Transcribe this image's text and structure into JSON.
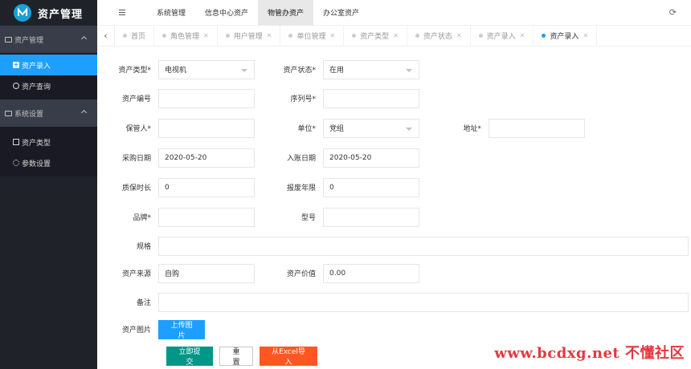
{
  "brand": {
    "title": "资产管理"
  },
  "sidebar": {
    "groups": [
      {
        "label": "资产管理",
        "items": [
          {
            "label": "资产录入"
          },
          {
            "label": "资产查询"
          }
        ]
      },
      {
        "label": "系统设置",
        "items": [
          {
            "label": "资产类型"
          },
          {
            "label": "参数设置"
          }
        ]
      }
    ]
  },
  "header": {
    "nav": [
      "系统管理",
      "信息中心资产",
      "物管办资产",
      "办公室资产"
    ]
  },
  "tabs": [
    "首页",
    "角色管理",
    "用户管理",
    "单位管理",
    "资产类型",
    "资产状态",
    "资产录入",
    "资产录入"
  ],
  "form": {
    "asset_type": {
      "label": "资产类型*",
      "value": "电视机"
    },
    "asset_status": {
      "label": "资产状态*",
      "value": "在用"
    },
    "asset_no": {
      "label": "资产编号",
      "value": ""
    },
    "serial_no": {
      "label": "序列号*",
      "value": ""
    },
    "keeper": {
      "label": "保管人*",
      "value": ""
    },
    "unit": {
      "label": "单位*",
      "value": "党组"
    },
    "address": {
      "label": "地址*",
      "value": ""
    },
    "purchase_date": {
      "label": "采购日期",
      "value": "2020-05-20"
    },
    "entry_date": {
      "label": "入账日期",
      "value": "2020-05-20"
    },
    "warranty": {
      "label": "质保时长",
      "value": "0"
    },
    "scrap_years": {
      "label": "报废年限",
      "value": "0"
    },
    "brand": {
      "label": "品牌*",
      "value": ""
    },
    "model": {
      "label": "型号",
      "value": ""
    },
    "spec": {
      "label": "规格",
      "value": ""
    },
    "source": {
      "label": "资产来源",
      "value": "自购"
    },
    "price": {
      "label": "资产价值",
      "value": "0.00"
    },
    "remark": {
      "label": "备注",
      "value": ""
    },
    "image": {
      "label": "资产图片",
      "upload_label": "上传图片"
    },
    "buttons": {
      "submit": "立即提交",
      "reset": "重置",
      "import": "从Excel导入"
    }
  },
  "watermark": "www.bcdxg.net 不懂社区"
}
